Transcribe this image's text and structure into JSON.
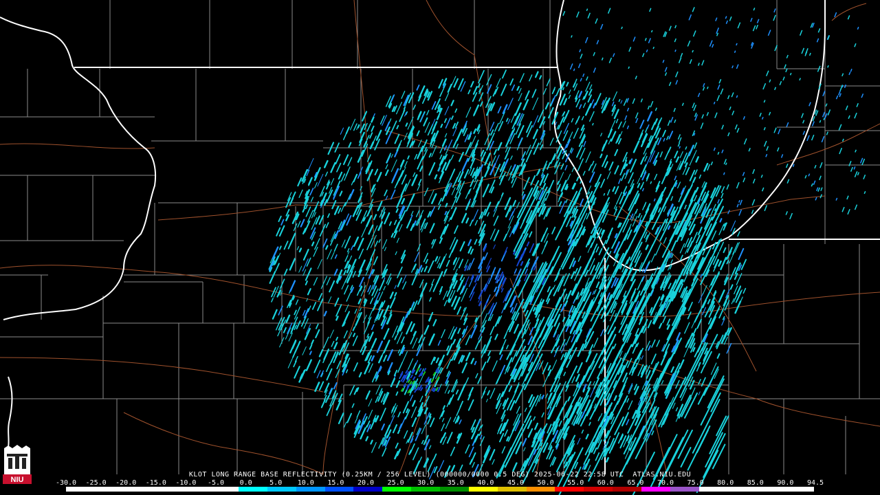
{
  "product": {
    "caption": "KLOT LONG RANGE BASE REFLECTIVITY (0.25KM / 256 LEVEL) (000000/0000 0.5 DEG) 2025-06-22 22:58 UTC  ATLAS.NIU.EDU"
  },
  "logo": {
    "text": "NIU",
    "color": "#c8102e"
  },
  "colorscale": {
    "labels": [
      "-30.0",
      "-25.0",
      "-20.0",
      "-15.0",
      "-10.0",
      "-5.0",
      "0.0",
      "5.0",
      "10.0",
      "15.0",
      "20.0",
      "25.0",
      "30.0",
      "35.0",
      "40.0",
      "45.0",
      "50.0",
      "55.0",
      "60.0",
      "65.0",
      "70.0",
      "75.0",
      "80.0",
      "85.0",
      "90.0",
      "94.5"
    ],
    "colors": [
      "#ffffff",
      "#ffffff",
      "#ffffff",
      "#ffffff",
      "#ffffff",
      "#ffffff",
      "#00ffff",
      "#00c8ff",
      "#0096ff",
      "#0050ff",
      "#0000c8",
      "#00ff00",
      "#00c000",
      "#009000",
      "#ffff00",
      "#e0c000",
      "#ff9000",
      "#ff0000",
      "#d00000",
      "#b00000",
      "#ff00ff",
      "#9a55c8",
      "#ffffff",
      "#ffffff",
      "#ffffff",
      "#ffffff"
    ]
  },
  "colors": {
    "background": "#000000",
    "state_border": "#ffffff",
    "county": "#8c8c8c",
    "highway": "#a0522d",
    "echo_light": "#19d2dc",
    "echo_mid": "#1e90ff",
    "echo_heavy": "#1446d2",
    "echo_green": "#18c418"
  }
}
